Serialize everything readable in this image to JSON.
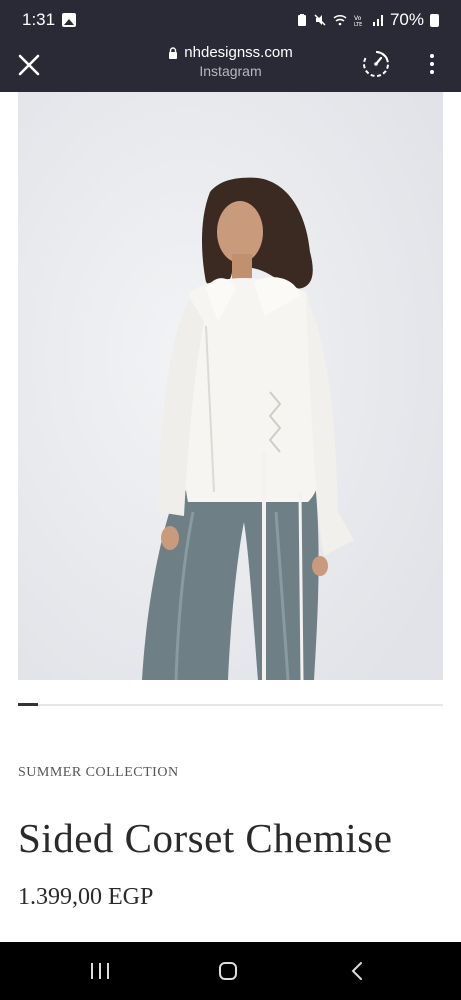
{
  "status": {
    "time": "1:31",
    "battery": "70%",
    "icons": [
      "gallery-icon",
      "battery-saver-icon",
      "mute-icon",
      "wifi-icon",
      "volte-icon",
      "signal-icon",
      "battery-icon"
    ]
  },
  "browser": {
    "url": "nhdesignss.com",
    "source": "Instagram",
    "icons": [
      "close-icon",
      "lock-icon",
      "speed-icon",
      "more-vert-icon"
    ]
  },
  "product": {
    "collection": "SUMMER COLLECTION",
    "title": "Sided Corset Chemise",
    "price": "1.399,00 EGP",
    "image_description": "model-photo"
  },
  "navigation": {
    "icons": [
      "recents-icon",
      "home-icon",
      "back-icon"
    ]
  },
  "colors": {
    "chrome_bg": "#2a2a36",
    "nav_bg": "#000000",
    "text_dark": "#2a2a2a"
  }
}
